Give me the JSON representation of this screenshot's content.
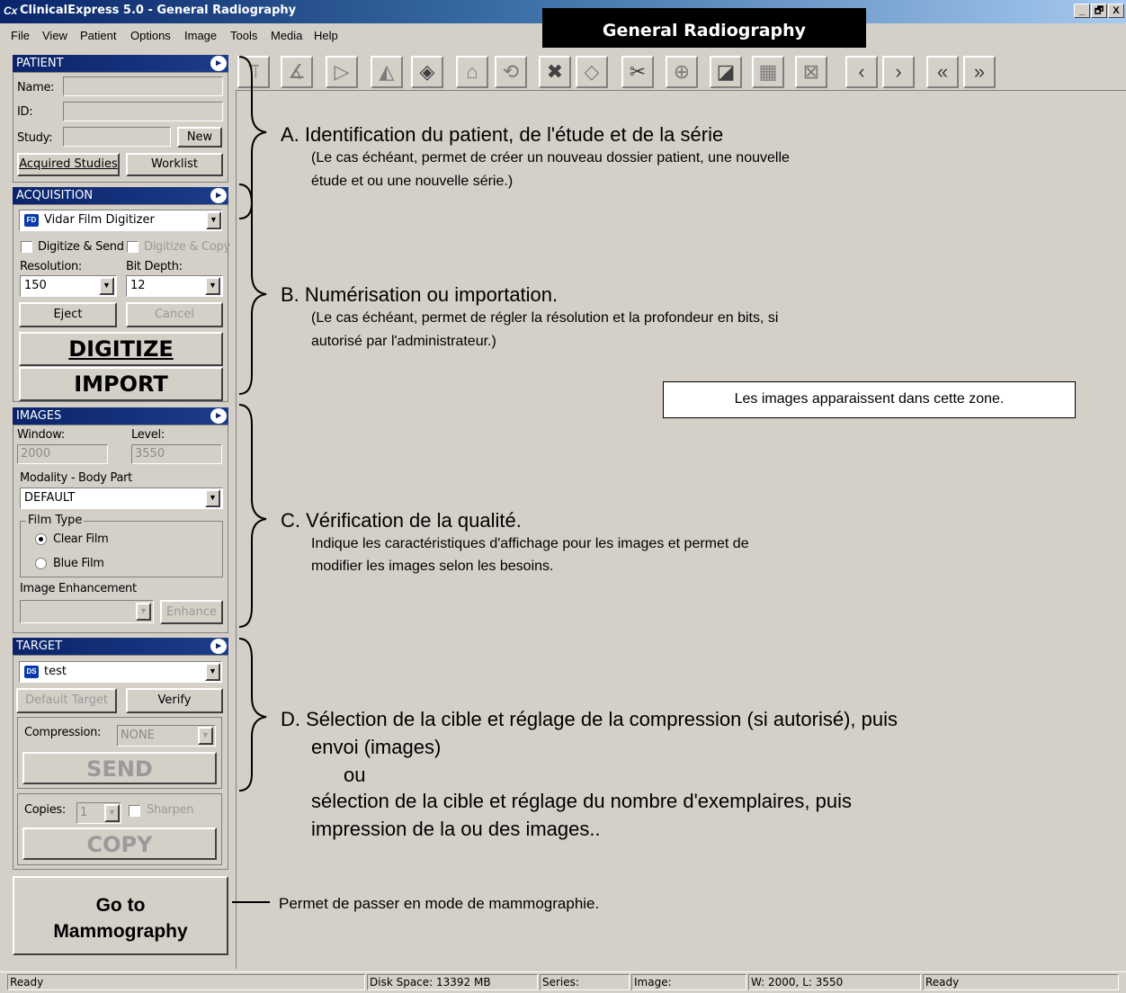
{
  "window": {
    "title": "ClinicalExpress 5.0 - General Radiography",
    "app_icon": "Cx",
    "controls": [
      "_",
      "🗗",
      "X"
    ]
  },
  "banner": "General Radiography",
  "menu": [
    "File",
    "View",
    "Patient",
    "Options",
    "Image",
    "Tools",
    "Media",
    "Help"
  ],
  "patient": {
    "header": "PATIENT",
    "name_label": "Name:",
    "id_label": "ID:",
    "study_label": "Study:",
    "new_button": "New",
    "acquired_button": "Acquired Studies",
    "worklist_button": "Worklist"
  },
  "acquisition": {
    "header": "ACQUISITION",
    "device_badge": "FD",
    "device": "Vidar Film Digitizer",
    "digitize_send": "Digitize & Send",
    "digitize_copy": "Digitize & Copy",
    "resolution_label": "Resolution:",
    "resolution_value": "150",
    "bitdepth_label": "Bit Depth:",
    "bitdepth_value": "12",
    "eject_button": "Eject",
    "cancel_button": "Cancel",
    "digitize_button": "DIGITIZE",
    "import_button": "IMPORT"
  },
  "images": {
    "header": "IMAGES",
    "window_label": "Window:",
    "window_value": "2000",
    "level_label": "Level:",
    "level_value": "3550",
    "modality_label": "Modality - Body Part",
    "modality_value": "DEFAULT",
    "film_type_label": "Film Type",
    "clear_film": "Clear Film",
    "blue_film": "Blue Film",
    "enhancement_label": "Image Enhancement",
    "enhance_button": "Enhance"
  },
  "target": {
    "header": "TARGET",
    "target_badge": "DS",
    "target_value": "test",
    "default_target_button": "Default Target",
    "verify_button": "Verify",
    "compression_label": "Compression:",
    "compression_value": "NONE",
    "send_button": "SEND",
    "copies_label": "Copies:",
    "copies_value": "1",
    "sharpen_label": "Sharpen",
    "copy_button": "COPY"
  },
  "mammo_button": {
    "line1": "Go to",
    "line2": "Mammography"
  },
  "annotations": {
    "a_title": "A. Identification du patient, de l'étude et de la série",
    "a_sub1": "(Le cas échéant, permet de créer un nouveau dossier patient, une nouvelle",
    "a_sub2": "étude et ou une nouvelle série.)",
    "b_title": "B. Numérisation ou importation.",
    "b_sub1": "(Le cas échéant, permet de régler la résolution et la profondeur en bits, si",
    "b_sub2": "autorisé par l'administrateur.)",
    "image_zone": "Les images apparaissent dans cette zone.",
    "c_title": "C. Vérification de la qualité.",
    "c_sub1": "Indique les caractéristiques d'affichage pour les images et permet de",
    "c_sub2": "modifier les images selon les besoins.",
    "d_line1": "D. Sélection de la cible et réglage de la compression (si autorisé), puis",
    "d_line2": "envoi (images)",
    "d_line3": "ou",
    "d_line4": "sélection de la cible et réglage du nombre d'exemplaires, puis",
    "d_line5": "impression de la ou des images..",
    "mammo_note": "Permet de passer en mode de mammographie."
  },
  "toolbar_icons": [
    "flip-vertical-icon",
    "rotate-measure-icon",
    "pointer-icon",
    "flip-horizontal-icon",
    "fit-screen-icon",
    "home-icon",
    "rotate-page-icon",
    "delete-icon",
    "fill-icon",
    "cut-icon",
    "zoom-icon",
    "paint-icon",
    "grid-icon",
    "tile-icon",
    "prev-icon",
    "next-icon",
    "first-icon",
    "last-icon"
  ],
  "statusbar": {
    "left": "Ready",
    "disk": "Disk Space: 13392 MB",
    "series": "Series:",
    "image": "Image:",
    "wl": "W: 2000, L: 3550",
    "right": "Ready"
  },
  "colors": {
    "titlebar": "#0a246a",
    "panel": "#d4d0c8",
    "section_header": "#0a246a"
  }
}
